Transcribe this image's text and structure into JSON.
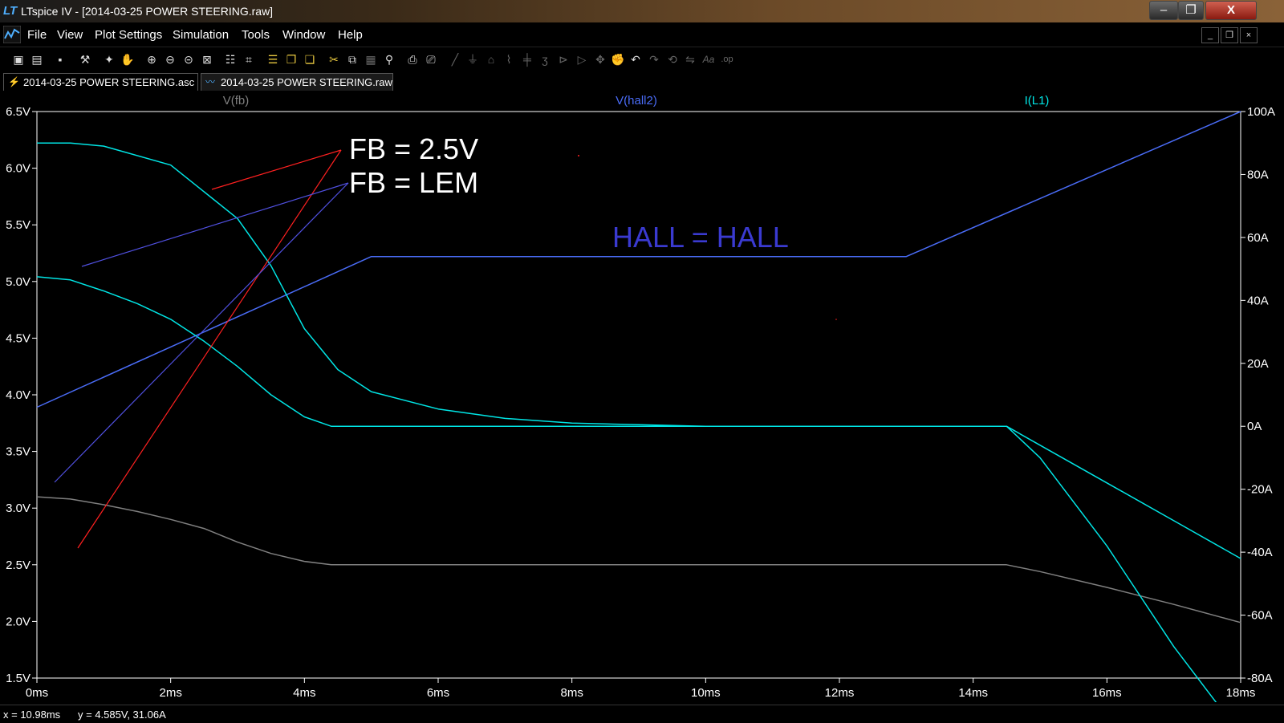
{
  "window": {
    "title": "LTspice IV - [2014-03-25 POWER STEERING.raw]",
    "app_icon": "ltspice-logo-icon",
    "buttons": {
      "minimize": "–",
      "maximize": "❐",
      "close": "X"
    }
  },
  "menu": {
    "items": [
      "File",
      "View",
      "Plot Settings",
      "Simulation",
      "Tools",
      "Window",
      "Help"
    ],
    "mdi_buttons": [
      "_",
      "❐",
      "×"
    ]
  },
  "toolbar": {
    "icons": [
      "new-schematic-icon",
      "open-icon",
      "save-icon",
      "control-panel-icon",
      "run-icon",
      "pan-icon",
      "zoom-in-icon",
      "zoom-out-icon",
      "zoom-back-icon",
      "zoom-fit-icon",
      "autorange-icon",
      "mark-icon",
      "tile-horizontal-icon",
      "tile-vertical-icon",
      "cascade-icon",
      "cut-icon",
      "copy-icon",
      "paste-icon",
      "find-icon",
      "print-preview-icon",
      "print-icon",
      "wire-icon",
      "ground-icon",
      "label-icon",
      "resistor-icon",
      "capacitor-icon",
      "inductor-icon",
      "diode-icon",
      "component-icon",
      "move-icon",
      "drag-icon",
      "undo-icon",
      "redo-icon",
      "rotate-icon",
      "mirror-icon",
      "text-icon",
      "spice-directive-icon"
    ]
  },
  "tabs": [
    {
      "label": "2014-03-25 POWER STEERING.asc",
      "icon": "schematic-icon"
    },
    {
      "label": "2014-03-25 POWER STEERING.raw",
      "icon": "waveform-icon"
    }
  ],
  "colors": {
    "background": "#000000",
    "grid": "#ffffff",
    "fb": "#808080",
    "hall2": "#4a6cf7",
    "current": "#00e5e5",
    "annotation_red": "#ff2020",
    "annotation_blue": "#5050e0",
    "hall_text": "#3a3ad0"
  },
  "chart_data": {
    "type": "line",
    "xlabel": "",
    "xlim": [
      0,
      18
    ],
    "x_unit": "ms",
    "x_ticks": [
      "0ms",
      "2ms",
      "4ms",
      "6ms",
      "8ms",
      "10ms",
      "12ms",
      "14ms",
      "16ms",
      "18ms"
    ],
    "y_left_ticks": [
      "6.5V",
      "6.0V",
      "5.5V",
      "5.0V",
      "4.5V",
      "4.0V",
      "3.5V",
      "3.0V",
      "2.5V",
      "2.0V",
      "1.5V"
    ],
    "y_left_lim": [
      1.5,
      6.5
    ],
    "y_right_ticks": [
      "100A",
      "80A",
      "60A",
      "40A",
      "20A",
      "0A",
      "-20A",
      "-40A",
      "-60A",
      "-80A"
    ],
    "y_right_lim": [
      -80,
      100
    ],
    "legend": [
      "V(fb)",
      "V(hall2)",
      "I(L1)"
    ],
    "series": [
      {
        "name": "V(fb)",
        "axis": "left",
        "color": "#808080",
        "x": [
          0,
          0.5,
          1,
          1.5,
          2,
          2.5,
          3,
          3.5,
          4,
          4.4,
          8,
          12,
          14.5,
          15,
          16,
          17,
          18
        ],
        "y": [
          3.1,
          3.08,
          3.03,
          2.97,
          2.9,
          2.82,
          2.7,
          2.6,
          2.53,
          2.5,
          2.5,
          2.5,
          2.5,
          2.44,
          2.3,
          2.15,
          1.99
        ]
      },
      {
        "name": "V(hall2)",
        "axis": "left",
        "color": "#4a6cf7",
        "x": [
          0,
          5,
          13,
          18
        ],
        "y": [
          3.89,
          5.22,
          5.22,
          6.5
        ]
      },
      {
        "name": "I(L1) a",
        "axis": "right",
        "color": "#00e5e5",
        "x": [
          0,
          0.5,
          1,
          2,
          3,
          3.5,
          4,
          4.5,
          5,
          6,
          7,
          8,
          9,
          10,
          14.5,
          15,
          16,
          17,
          18
        ],
        "y": [
          90,
          90,
          89,
          83,
          66,
          51,
          31,
          18,
          11,
          5.5,
          2.5,
          1,
          0.5,
          0,
          0,
          -10,
          -38,
          -70,
          -98
        ]
      },
      {
        "name": "I(L1) b",
        "axis": "right",
        "color": "#00e5e5",
        "x": [
          0,
          0.5,
          1,
          1.5,
          2,
          2.5,
          3,
          3.5,
          4,
          4.4,
          14.5,
          15,
          16,
          17,
          18
        ],
        "y": [
          47.5,
          46.5,
          43,
          39,
          34,
          27,
          19,
          10,
          3,
          0,
          0,
          -6,
          -18,
          -30,
          -42
        ]
      }
    ],
    "annotations": [
      {
        "text": "FB = 2.5V",
        "color": "#ffffff"
      },
      {
        "text": "FB = LEM",
        "color": "#ffffff"
      },
      {
        "text": "HALL = HALL",
        "color": "#3a3ad0"
      }
    ]
  },
  "status": {
    "x": "x = 10.98ms",
    "y": "y = 4.585V, 31.06A"
  }
}
